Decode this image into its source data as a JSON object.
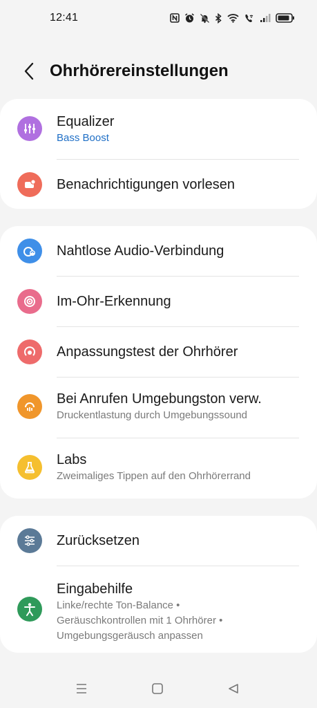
{
  "status_bar": {
    "time": "12:41",
    "icons": [
      "nfc-icon",
      "alarm-icon",
      "mute-icon",
      "bluetooth-icon",
      "wifi-icon",
      "wifi-call-icon",
      "signal-icon",
      "battery-icon"
    ]
  },
  "header": {
    "title": "Ohrhörereinstellungen",
    "back_icon": "back-arrow-icon"
  },
  "group1": [
    {
      "title": "Equalizer",
      "subtitle": "Bass Boost",
      "icon": "equalizer-icon",
      "color": "#b070e0"
    },
    {
      "title": "Benachrichtigungen vorlesen",
      "icon": "notification-read-icon",
      "color": "#ef6c5a"
    }
  ],
  "group2": [
    {
      "title": "Nahtlose Audio-Verbindung",
      "icon": "audio-connection-icon",
      "color": "#3f8fe8"
    },
    {
      "title": "Im-Ohr-Erkennung",
      "icon": "in-ear-detection-icon",
      "color": "#e96c8c"
    },
    {
      "title": "Anpassungstest der Ohrhörer",
      "icon": "fit-test-icon",
      "color": "#ee6b6b"
    },
    {
      "title": "Bei Anrufen Umgebungston verw.",
      "subtitle": "Druckentlastung durch Umgebungssound",
      "icon": "ambient-sound-icon",
      "color": "#f0962b"
    },
    {
      "title": "Labs",
      "subtitle": "Zweimaliges Tippen auf den Ohrhörerrand",
      "icon": "labs-flask-icon",
      "color": "#f5bf2f"
    }
  ],
  "group3": [
    {
      "title": "Zurücksetzen",
      "icon": "reset-sliders-icon",
      "color": "#5b7a97"
    },
    {
      "title": "Eingabehilfe",
      "subtitle_lines": [
        "Linke/rechte Ton-Balance  •",
        "Geräuschkontrollen mit 1 Ohrhörer  •",
        "Umgebungsgeräusch anpassen"
      ],
      "icon": "accessibility-icon",
      "color": "#2f9a5a"
    }
  ],
  "nav": {
    "icons": [
      "recents-icon",
      "home-icon",
      "back-icon"
    ]
  }
}
